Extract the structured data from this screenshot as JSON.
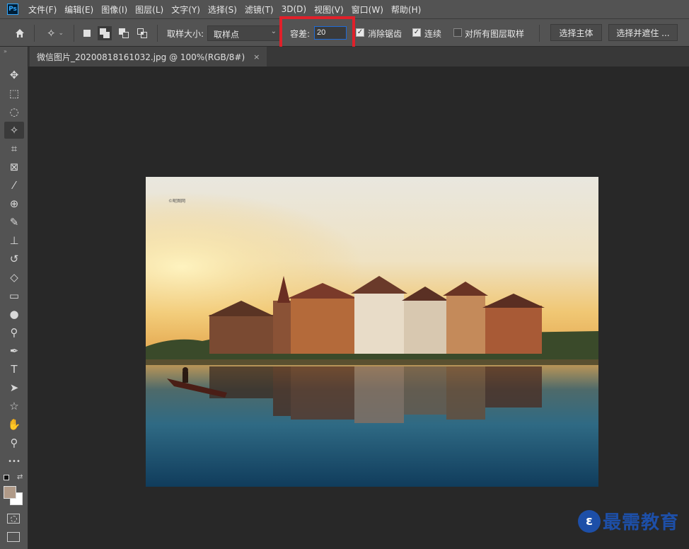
{
  "app": {
    "logo": "Ps"
  },
  "menu": [
    "文件(F)",
    "编辑(E)",
    "图像(I)",
    "图层(L)",
    "文字(Y)",
    "选择(S)",
    "滤镜(T)",
    "3D(D)",
    "视图(V)",
    "窗口(W)",
    "帮助(H)"
  ],
  "options": {
    "sample_size_label": "取样大小:",
    "sample_size_value": "取样点",
    "tolerance_label": "容差:",
    "tolerance_value": "20",
    "anti_alias_label": "消除锯齿",
    "anti_alias_checked": true,
    "contiguous_label": "连续",
    "contiguous_checked": true,
    "sample_all_layers_label": "对所有图层取样",
    "sample_all_layers_checked": false,
    "select_subject_label": "选择主体",
    "select_and_mask_label": "选择并遮住 ..."
  },
  "document": {
    "tab_title": "微信图片_20200818161032.jpg @ 100%(RGB/8#)",
    "close_glyph": "×",
    "image_tag": "©昵图网"
  },
  "tools": [
    {
      "name": "move-tool-icon",
      "glyph": "✥"
    },
    {
      "name": "marquee-tool-icon",
      "glyph": "⬚"
    },
    {
      "name": "lasso-tool-icon",
      "glyph": "◌"
    },
    {
      "name": "magic-wand-tool-icon",
      "glyph": "✧",
      "active": true
    },
    {
      "name": "crop-tool-icon",
      "glyph": "⌗"
    },
    {
      "name": "frame-tool-icon",
      "glyph": "⊠"
    },
    {
      "name": "eyedropper-tool-icon",
      "glyph": "⁄"
    },
    {
      "name": "healing-brush-tool-icon",
      "glyph": "⊕"
    },
    {
      "name": "brush-tool-icon",
      "glyph": "✎"
    },
    {
      "name": "clone-stamp-tool-icon",
      "glyph": "⊥"
    },
    {
      "name": "history-brush-tool-icon",
      "glyph": "↺"
    },
    {
      "name": "eraser-tool-icon",
      "glyph": "◇"
    },
    {
      "name": "gradient-tool-icon",
      "glyph": "▭"
    },
    {
      "name": "blur-tool-icon",
      "glyph": "●"
    },
    {
      "name": "dodge-tool-icon",
      "glyph": "⚲"
    },
    {
      "name": "pen-tool-icon",
      "glyph": "✒"
    },
    {
      "name": "type-tool-icon",
      "glyph": "T"
    },
    {
      "name": "path-selection-tool-icon",
      "glyph": "➤"
    },
    {
      "name": "shape-tool-icon",
      "glyph": "☆"
    },
    {
      "name": "hand-tool-icon",
      "glyph": "✋"
    },
    {
      "name": "zoom-tool-icon",
      "glyph": "⚲"
    },
    {
      "name": "more-tools-icon",
      "glyph": "•••"
    }
  ],
  "colors": {
    "foreground": "#b09a88",
    "background": "#ffffff",
    "highlight_box": "#e0202a"
  },
  "watermark": {
    "text": "最需教育",
    "logo_glyph": "ε"
  }
}
